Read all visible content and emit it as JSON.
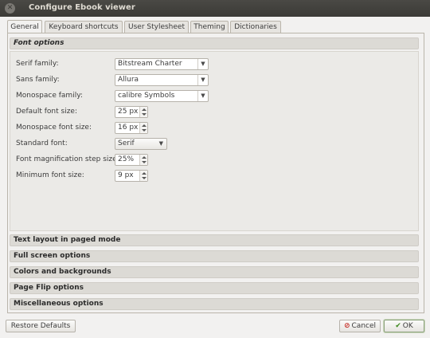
{
  "window": {
    "title": "Configure Ebook viewer"
  },
  "tabs": [
    {
      "label": "General",
      "active": true
    },
    {
      "label": "Keyboard shortcuts"
    },
    {
      "label": "User Stylesheet"
    },
    {
      "label": "Theming"
    },
    {
      "label": "Dictionaries"
    }
  ],
  "font_options": {
    "header": "Font options",
    "fields": {
      "serif_family": {
        "label": "Serif family:",
        "value": "Bitstream Charter"
      },
      "sans_family": {
        "label": "Sans family:",
        "value": "Allura"
      },
      "monospace_family": {
        "label": "Monospace family:",
        "value": "calibre Symbols"
      },
      "default_font_size": {
        "label": "Default font size:",
        "value": "25 px"
      },
      "monospace_font_size": {
        "label": "Monospace font size:",
        "value": "16 px"
      },
      "standard_font": {
        "label": "Standard font:",
        "value": "Serif"
      },
      "font_magnification_step": {
        "label": "Font magnification step size:",
        "value": "25%"
      },
      "minimum_font_size": {
        "label": "Minimum font size:",
        "value": "9 px"
      }
    }
  },
  "sections": {
    "text_layout": "Text layout in paged mode",
    "full_screen": "Full screen options",
    "colors": "Colors and backgrounds",
    "page_flip": "Page Flip options",
    "misc": "Miscellaneous options"
  },
  "buttons": {
    "restore_defaults": "Restore Defaults",
    "cancel": "Cancel",
    "ok": "OK"
  },
  "icons": {
    "close": "close-icon",
    "dropdown": "chevron-down-icon",
    "cancel": "cancel-icon",
    "ok": "checkmark-icon"
  }
}
